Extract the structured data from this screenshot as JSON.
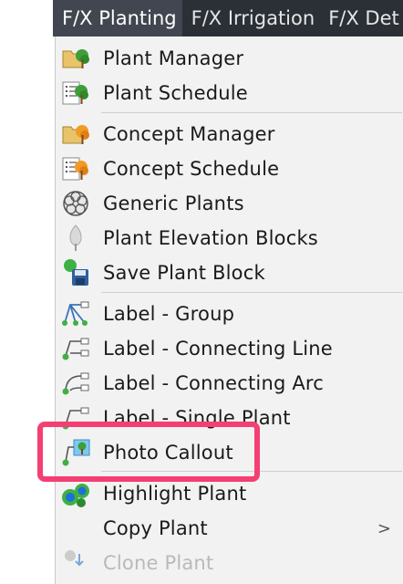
{
  "menubar": {
    "tabs": [
      {
        "label": "F/X Planting"
      },
      {
        "label": "F/X Irrigation"
      },
      {
        "label": "F/X Det"
      }
    ]
  },
  "menu": {
    "items": [
      {
        "label": "Plant Manager",
        "icon": "plant-manager-icon"
      },
      {
        "label": "Plant Schedule",
        "icon": "plant-schedule-icon"
      },
      {
        "label": "Concept Manager",
        "icon": "concept-manager-icon"
      },
      {
        "label": "Concept Schedule",
        "icon": "concept-schedule-icon"
      },
      {
        "label": "Generic Plants",
        "icon": "generic-plants-icon"
      },
      {
        "label": "Plant Elevation Blocks",
        "icon": "elevation-blocks-icon"
      },
      {
        "label": "Save Plant Block",
        "icon": "save-block-icon"
      },
      {
        "label": "Label - Group",
        "icon": "label-group-icon"
      },
      {
        "label": "Label - Connecting Line",
        "icon": "label-line-icon"
      },
      {
        "label": "Label - Connecting Arc",
        "icon": "label-arc-icon"
      },
      {
        "label": "Label - Single Plant",
        "icon": "label-single-icon"
      },
      {
        "label": "Photo Callout",
        "icon": "photo-callout-icon"
      },
      {
        "label": "Highlight Plant",
        "icon": "highlight-plant-icon"
      },
      {
        "label": "Copy Plant",
        "icon": "",
        "submenu": ">"
      },
      {
        "label": "Clone Plant",
        "icon": "clone-plant-icon"
      }
    ]
  },
  "colors": {
    "menubar_bg": "#2b2f36",
    "menu_bg": "#f2f2f2",
    "highlight": "#f43f72",
    "tree_green": "#3f9e3a",
    "tree_orange": "#f29a23"
  }
}
